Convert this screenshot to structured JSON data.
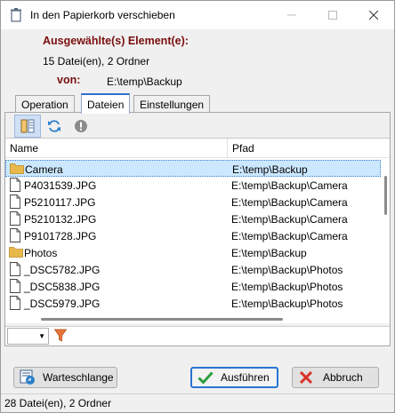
{
  "window": {
    "title": "In den Papierkorb verschieben"
  },
  "header": {
    "selected_label": "Ausgewählte(s) Element(e):",
    "selected_count": "15 Datei(en), 2 Ordner",
    "from_label": "von:",
    "from_path": "E:\\temp\\Backup"
  },
  "tabs": [
    {
      "label": "Operation",
      "active": false
    },
    {
      "label": "Dateien",
      "active": true
    },
    {
      "label": "Einstellungen",
      "active": false
    }
  ],
  "toolbar": {
    "icons": [
      "columns-view-icon",
      "refresh-icon",
      "warning-icon"
    ]
  },
  "list": {
    "columns": [
      "Name",
      "Pfad"
    ],
    "rows": [
      {
        "type": "folder",
        "name": "Camera",
        "path": "E:\\temp\\Backup",
        "selected": true
      },
      {
        "type": "file",
        "name": "P4031539.JPG",
        "path": "E:\\temp\\Backup\\Camera"
      },
      {
        "type": "file",
        "name": "P5210117.JPG",
        "path": "E:\\temp\\Backup\\Camera"
      },
      {
        "type": "file",
        "name": "P5210132.JPG",
        "path": "E:\\temp\\Backup\\Camera"
      },
      {
        "type": "file",
        "name": "P9101728.JPG",
        "path": "E:\\temp\\Backup\\Camera"
      },
      {
        "type": "folder",
        "name": "Photos",
        "path": "E:\\temp\\Backup"
      },
      {
        "type": "file",
        "name": "_DSC5782.JPG",
        "path": "E:\\temp\\Backup\\Photos"
      },
      {
        "type": "file",
        "name": "_DSC5838.JPG",
        "path": "E:\\temp\\Backup\\Photos"
      },
      {
        "type": "file",
        "name": "_DSC5979.JPG",
        "path": "E:\\temp\\Backup\\Photos"
      }
    ]
  },
  "filter": {
    "selected_value": ""
  },
  "buttons": {
    "queue": "Warteschlange",
    "execute": "Ausführen",
    "cancel": "Abbruch"
  },
  "status": {
    "text": "28 Datei(en), 2 Ordner"
  },
  "colors": {
    "header_label": "#7a0f0f",
    "accent": "#2a74d3",
    "selection": "#cce8ff",
    "folder": "#e8b84a",
    "cancel_red": "#d9342b",
    "ok_green": "#2e9e3e",
    "filter_orange": "#e8743a"
  }
}
